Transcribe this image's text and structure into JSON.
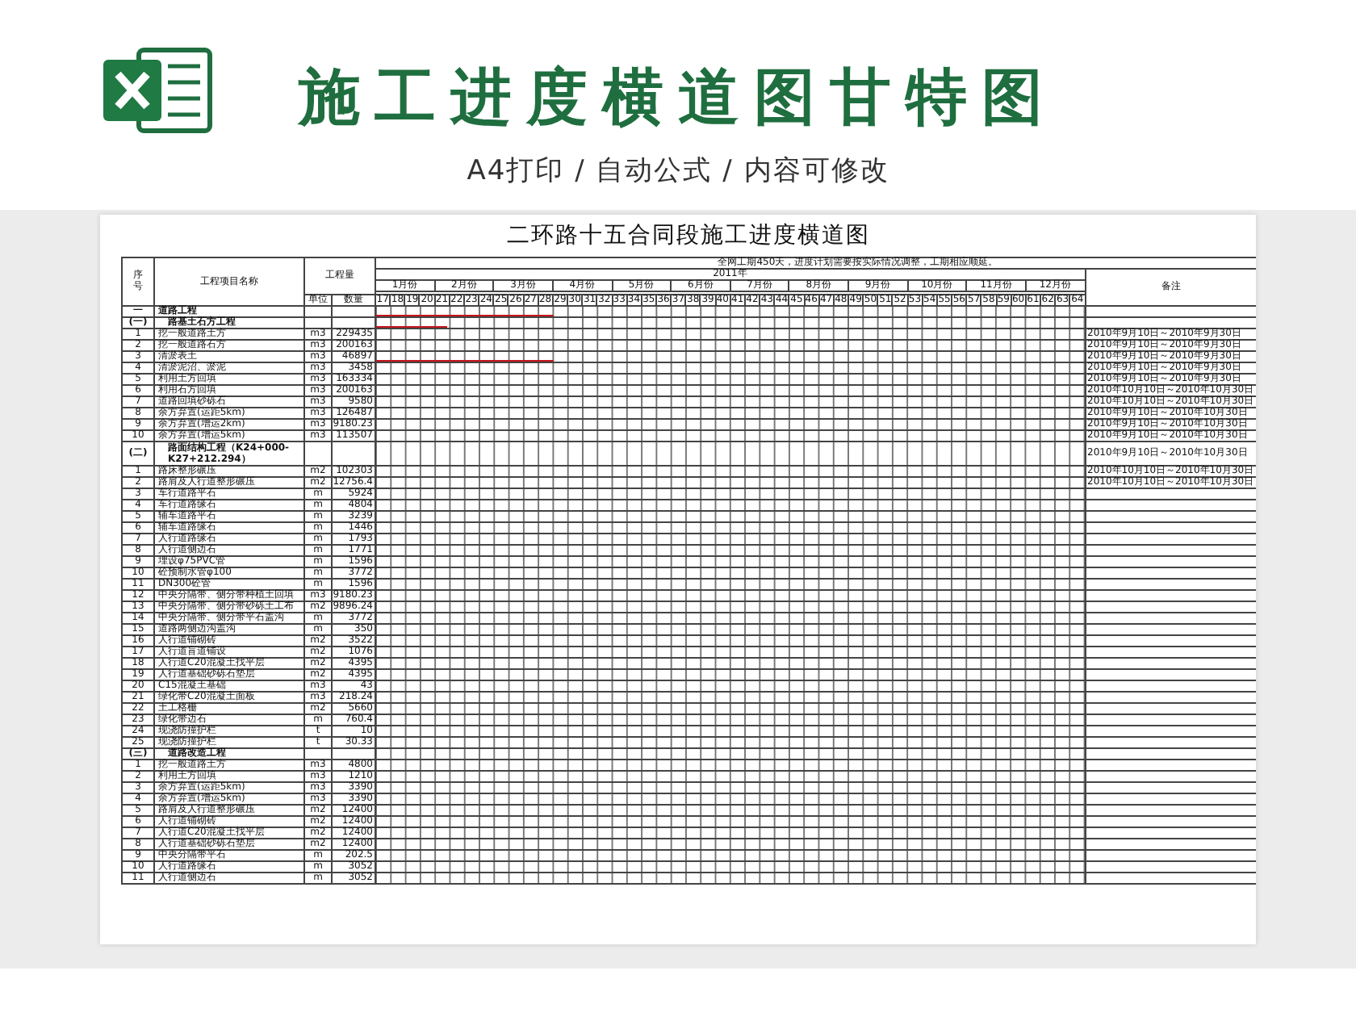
{
  "banner": {
    "title": "施工进度横道图甘特图",
    "subtitle": "A4打印 / 自动公式 / 内容可修改"
  },
  "sheet": {
    "title": "二环路十五合同段施工进度横道图",
    "headers": {
      "no": "序号",
      "name": "工程项目名称",
      "quantity": "工程量",
      "unit": "单位",
      "amount": "数量",
      "remark": "备注",
      "note": "全网工期450天，进度计划需要按实际情况调整，工期相应顺延。",
      "year": "2011年"
    },
    "months": [
      "1月份",
      "2月份",
      "3月份",
      "4月份",
      "5月份",
      "6月份",
      "7月份",
      "8月份",
      "9月份",
      "10月份",
      "11月份",
      "12月份"
    ],
    "weeks": [
      "17",
      "18",
      "19",
      "20",
      "21",
      "22",
      "23",
      "24",
      "25",
      "26",
      "27",
      "28",
      "29",
      "30",
      "31",
      "32",
      "33",
      "34",
      "35",
      "36",
      "37",
      "38",
      "39",
      "40",
      "41",
      "42",
      "43",
      "44",
      "45",
      "46",
      "47",
      "48",
      "49",
      "50",
      "51",
      "52",
      "53",
      "54",
      "55",
      "56",
      "57",
      "58",
      "59",
      "60",
      "61",
      "62",
      "63",
      "64"
    ],
    "rows": [
      {
        "kind": "section",
        "no": "一",
        "name": "道路工程",
        "level": 0.25
      },
      {
        "kind": "group",
        "no": "(一)",
        "name": "路基土石方工程",
        "level": 0.1
      },
      {
        "kind": "item",
        "no": "1",
        "name": "挖一般道路土方",
        "unit": "m3",
        "qty": "229435",
        "remark": "2010年9月10日～2010年9月30日"
      },
      {
        "kind": "item",
        "no": "2",
        "name": "挖一般道路石方",
        "unit": "m3",
        "qty": "200163",
        "remark": "2010年9月10日～2010年9月30日"
      },
      {
        "kind": "item",
        "no": "3",
        "name": "清淤表土",
        "unit": "m3",
        "qty": "46897",
        "remark": "2010年9月10日～2010年9月30日",
        "level": 0.25
      },
      {
        "kind": "item",
        "no": "4",
        "name": "清淤泥沼、淤泥",
        "unit": "m3",
        "qty": "3458",
        "remark": "2010年9月10日～2010年9月30日"
      },
      {
        "kind": "item",
        "no": "5",
        "name": "利用土方回填",
        "unit": "m3",
        "qty": "163334",
        "remark": "2010年9月10日～2010年9月30日"
      },
      {
        "kind": "item",
        "no": "6",
        "name": "利用石方回填",
        "unit": "m3",
        "qty": "200163",
        "remark": "2010年10月10日～2010年10月30日"
      },
      {
        "kind": "item",
        "no": "7",
        "name": "道路回填砂砾石",
        "unit": "m3",
        "qty": "9580",
        "remark": "2010年10月10日～2010年10月30日"
      },
      {
        "kind": "item",
        "no": "8",
        "name": "余方弃置(运距5km)",
        "unit": "m3",
        "qty": "126487",
        "remark": "2010年9月10日～2010年10月30日"
      },
      {
        "kind": "item",
        "no": "9",
        "name": "余方弃置(增运2km)",
        "unit": "m3",
        "qty": "9180.23",
        "remark": "2010年9月10日～2010年10月30日"
      },
      {
        "kind": "item",
        "no": "10",
        "name": "余方弃置(增运5km)",
        "unit": "m3",
        "qty": "113507",
        "remark": "2010年9月10日～2010年10月30日"
      },
      {
        "kind": "group",
        "no": "(二)",
        "name": "路面结构工程（K24+000-K27+212.294）",
        "remark": "2010年9月10日～2010年10月30日"
      },
      {
        "kind": "item",
        "no": "1",
        "name": "路床整形碾压",
        "unit": "m2",
        "qty": "102303",
        "remark": "2010年10月10日～2010年10月30日"
      },
      {
        "kind": "item",
        "no": "2",
        "name": "路肩及人行道整形碾压",
        "unit": "m2",
        "qty": "12756.4",
        "remark": "2010年10月10日～2010年10月30日"
      },
      {
        "kind": "item",
        "no": "3",
        "name": "车行道路平石",
        "unit": "m",
        "qty": "5924"
      },
      {
        "kind": "item",
        "no": "4",
        "name": "车行道路缘石",
        "unit": "m",
        "qty": "4804"
      },
      {
        "kind": "item",
        "no": "5",
        "name": "辅车道路平石",
        "unit": "m",
        "qty": "3239"
      },
      {
        "kind": "item",
        "no": "6",
        "name": "辅车道路缘石",
        "unit": "m",
        "qty": "1446"
      },
      {
        "kind": "item",
        "no": "7",
        "name": "人行道路缘石",
        "unit": "m",
        "qty": "1793"
      },
      {
        "kind": "item",
        "no": "8",
        "name": "人行道侧边石",
        "unit": "m",
        "qty": "1771"
      },
      {
        "kind": "item",
        "no": "9",
        "name": "埋设φ75PVC管",
        "unit": "m",
        "qty": "1596"
      },
      {
        "kind": "item",
        "no": "10",
        "name": "砼预制水管φ100",
        "unit": "m",
        "qty": "3772"
      },
      {
        "kind": "item",
        "no": "11",
        "name": "DN300砼管",
        "unit": "m",
        "qty": "1596"
      },
      {
        "kind": "item",
        "no": "12",
        "name": "中央分隔带、侧分带种植土回填",
        "unit": "m3",
        "qty": "9180.23"
      },
      {
        "kind": "item",
        "no": "13",
        "name": "中央分隔带、侧分带砂砾土工布",
        "unit": "m2",
        "qty": "9896.24"
      },
      {
        "kind": "item",
        "no": "14",
        "name": "中央分隔带、侧分带平石盖沟",
        "unit": "m",
        "qty": "3772"
      },
      {
        "kind": "item",
        "no": "15",
        "name": "道路两侧边沟盖沟",
        "unit": "m",
        "qty": "350"
      },
      {
        "kind": "item",
        "no": "16",
        "name": "人行道铺砌砖",
        "unit": "m2",
        "qty": "3522"
      },
      {
        "kind": "item",
        "no": "17",
        "name": "人行道盲道铺设",
        "unit": "m2",
        "qty": "1076"
      },
      {
        "kind": "item",
        "no": "18",
        "name": "人行道C20混凝土找平层",
        "unit": "m2",
        "qty": "4395"
      },
      {
        "kind": "item",
        "no": "19",
        "name": "人行道基础砂砾石垫层",
        "unit": "m2",
        "qty": "4395"
      },
      {
        "kind": "item",
        "no": "20",
        "name": "C15混凝土基础",
        "unit": "m3",
        "qty": "43"
      },
      {
        "kind": "item",
        "no": "21",
        "name": "绿化带C20混凝土面板",
        "unit": "m3",
        "qty": "218.24"
      },
      {
        "kind": "item",
        "no": "22",
        "name": "土工格栅",
        "unit": "m2",
        "qty": "5660"
      },
      {
        "kind": "item",
        "no": "23",
        "name": "绿化带边石",
        "unit": "m",
        "qty": "760.4"
      },
      {
        "kind": "item",
        "no": "24",
        "name": "现浇防撞护栏",
        "unit": "t",
        "qty": "10"
      },
      {
        "kind": "item",
        "no": "25",
        "name": "现浇防撞护栏",
        "unit": "t",
        "qty": "30.33"
      },
      {
        "kind": "group",
        "no": "(三)",
        "name": "道路改造工程"
      },
      {
        "kind": "item",
        "no": "1",
        "name": "挖一般道路土方",
        "unit": "m3",
        "qty": "4800"
      },
      {
        "kind": "item",
        "no": "2",
        "name": "利用土方回填",
        "unit": "m3",
        "qty": "1210"
      },
      {
        "kind": "item",
        "no": "3",
        "name": "余方弃置(运距5km)",
        "unit": "m3",
        "qty": "3390"
      },
      {
        "kind": "item",
        "no": "4",
        "name": "余方弃置(增运5km)",
        "unit": "m3",
        "qty": "3390"
      },
      {
        "kind": "item",
        "no": "5",
        "name": "路肩及人行道整形碾压",
        "unit": "m2",
        "qty": "12400"
      },
      {
        "kind": "item",
        "no": "6",
        "name": "人行道铺砌砖",
        "unit": "m2",
        "qty": "12400"
      },
      {
        "kind": "item",
        "no": "7",
        "name": "人行道C20混凝土找平层",
        "unit": "m2",
        "qty": "12400"
      },
      {
        "kind": "item",
        "no": "8",
        "name": "人行道基础砂砾石垫层",
        "unit": "m2",
        "qty": "12400"
      },
      {
        "kind": "item",
        "no": "9",
        "name": "中央分隔带平石",
        "unit": "m",
        "qty": "202.5"
      },
      {
        "kind": "item",
        "no": "10",
        "name": "人行道路缘石",
        "unit": "m",
        "qty": "3052"
      },
      {
        "kind": "item",
        "no": "11",
        "name": "人行道侧边石",
        "unit": "m",
        "qty": "3052"
      }
    ]
  }
}
